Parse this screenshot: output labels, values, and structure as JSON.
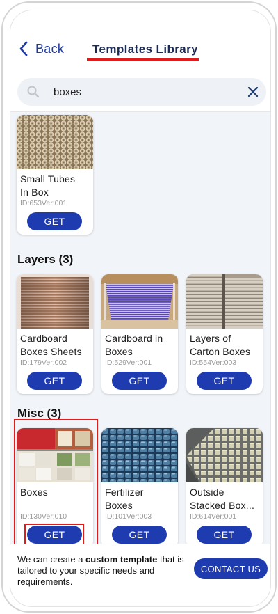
{
  "header": {
    "back_label": "Back",
    "title": "Templates Library",
    "accent_color": "#e01b1b"
  },
  "search": {
    "value": "boxes",
    "placeholder": ""
  },
  "sections": [
    {
      "title": "",
      "items": [
        {
          "name": "Small Tubes\nIn Box",
          "id_text": "ID:653Ver:001",
          "button": "GET"
        }
      ]
    },
    {
      "title": "Layers (3)",
      "items": [
        {
          "name": "Cardboard\nBoxes Sheets",
          "id_text": "ID:179Ver:002",
          "button": "GET"
        },
        {
          "name": "Cardboard in\nBoxes",
          "id_text": "ID:529Ver:001",
          "button": "GET"
        },
        {
          "name": "Layers of\nCarton Boxes",
          "id_text": "ID:554Ver:003",
          "button": "GET"
        }
      ]
    },
    {
      "title": "Misc (3)",
      "items": [
        {
          "name": "Boxes",
          "id_text": "ID:130Ver:010",
          "button": "GET"
        },
        {
          "name": "Fertilizer\nBoxes",
          "id_text": "ID:101Ver:003",
          "button": "GET"
        },
        {
          "name": "Outside\nStacked Box...",
          "id_text": "ID:614Ver:001",
          "button": "GET"
        }
      ]
    }
  ],
  "footer": {
    "text_before": "We can create a ",
    "text_bold": "custom template",
    "text_after": " that is tailored to your specific needs and requirements.",
    "contact_label": "CONTACT US"
  },
  "colors": {
    "primary_button": "#1e3bb0",
    "content_bg": "#f1f4f8",
    "title_color": "#1b2a52"
  },
  "icons": {
    "back": "chevron-left-icon",
    "search": "search-icon",
    "clear": "close-icon"
  }
}
